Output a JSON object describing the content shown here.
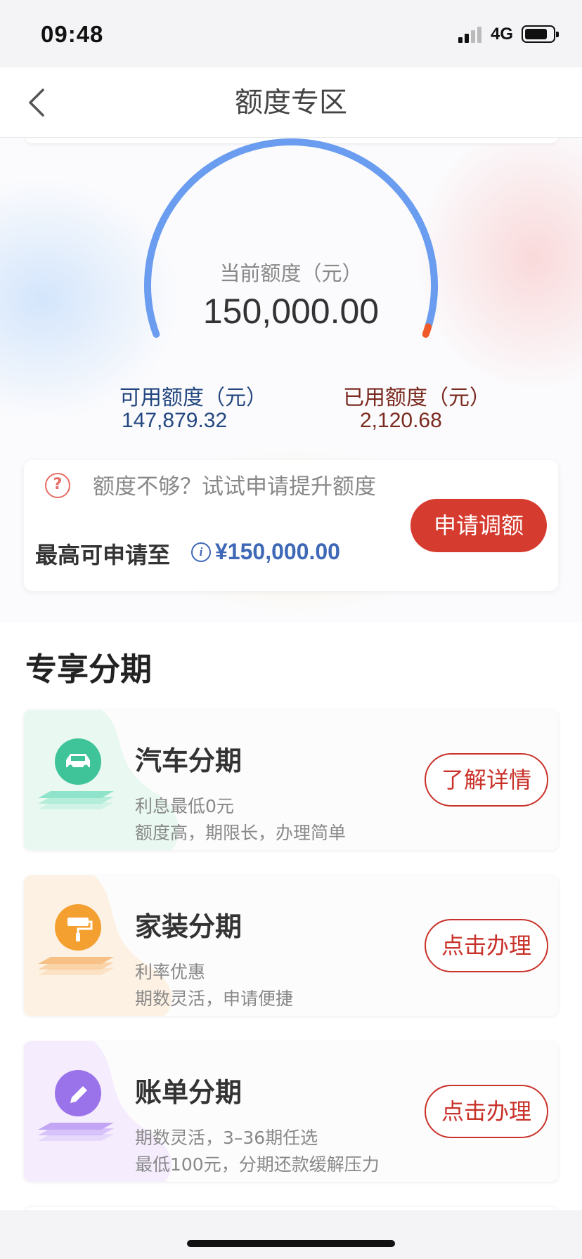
{
  "status_bar": {
    "time": "09:48",
    "network": "4G"
  },
  "nav": {
    "title": "额度专区"
  },
  "limit": {
    "current_label": "当前额度（元）",
    "current_value": "150,000.00",
    "available_label": "可用额度（元）",
    "available_value": "147,879.32",
    "used_label": "已用额度（元）",
    "used_value": "2,120.68",
    "available_fraction": 0.9859
  },
  "raise": {
    "prompt": "额度不够？试试申请提升额度",
    "max_label": "最高可申请至",
    "max_value": "¥150,000.00",
    "apply_label": "申请调额"
  },
  "installments": {
    "title": "专享分期",
    "items": [
      {
        "title": "汽车分期",
        "sub1": "利息最低0元",
        "sub2": "额度高，期限长，办理简单",
        "button": "了解详情",
        "icon": "car-icon",
        "color": "#3fc49a"
      },
      {
        "title": "家装分期",
        "sub1": "利率优惠",
        "sub2": "期数灵活，申请便捷",
        "button": "点击办理",
        "icon": "paint-roller-icon",
        "color": "#f4a030"
      },
      {
        "title": "账单分期",
        "sub1": "期数灵活，3–36期任选",
        "sub2": "最低100元，分期还款缓解压力",
        "button": "点击办理",
        "icon": "pencil-icon",
        "color": "#9a73ea"
      }
    ]
  },
  "colors": {
    "accent_red": "#d63b2f",
    "gauge_blue": "#6a9cf0",
    "gauge_used": "#f05a2a",
    "max_blue": "#3f68b7"
  }
}
